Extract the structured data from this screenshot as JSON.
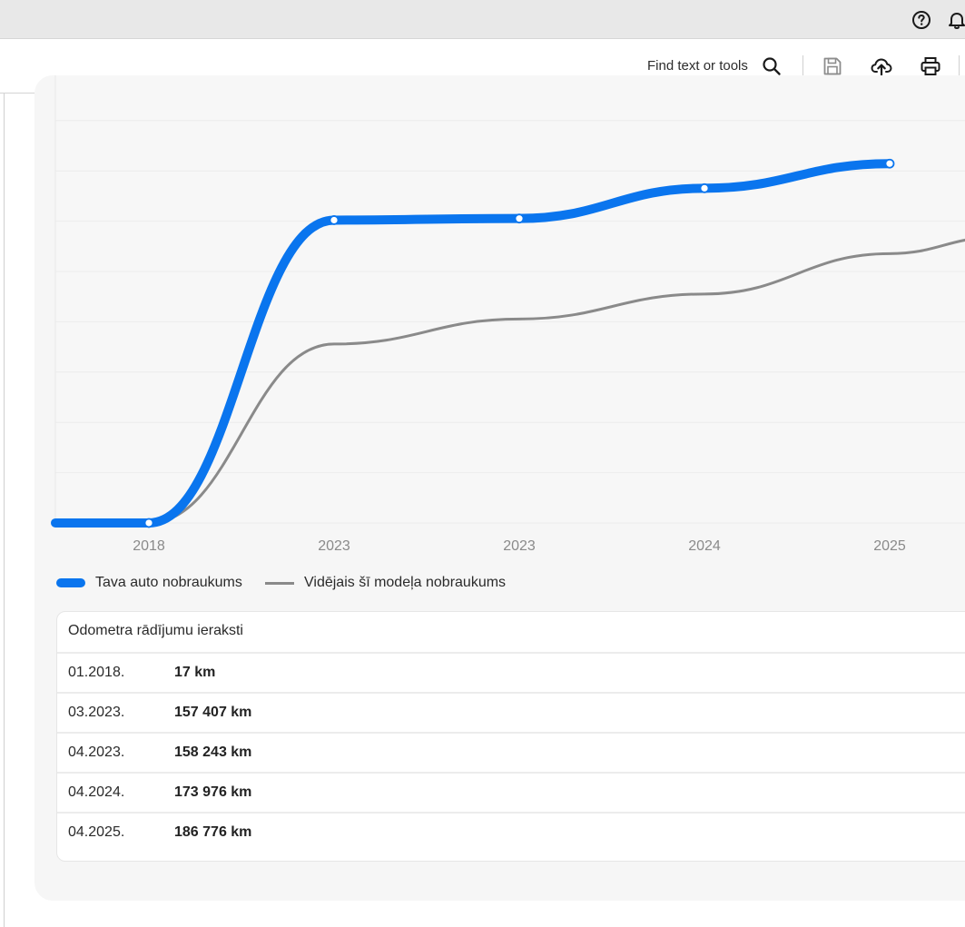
{
  "toolbar": {
    "find_label": "Find text or tools"
  },
  "icons": {
    "help": "help-circle-icon",
    "notifications": "bell-icon",
    "search": "search-icon",
    "save": "save-icon",
    "upload": "cloud-upload-icon",
    "print": "print-icon"
  },
  "chart_data": {
    "type": "line",
    "categories": [
      "2018",
      "2023",
      "2023",
      "2024",
      "2025"
    ],
    "series": [
      {
        "name": "Tava auto nobraukums",
        "color": "#0a75ee",
        "values": [
          17,
          157407,
          158243,
          173976,
          186776
        ]
      },
      {
        "name": "Vidējais šī modeļa nobraukums",
        "color": "#8a8a8a",
        "values": [
          17,
          93000,
          106000,
          119000,
          140000
        ]
      }
    ],
    "ylim": [
      0,
      210000
    ],
    "grid": true,
    "legend": "bottom-left"
  },
  "records": {
    "title": "Odometra rādījumu ieraksti",
    "rows": [
      {
        "date": "01.2018.",
        "km": "17 km"
      },
      {
        "date": "03.2023.",
        "km": "157 407 km"
      },
      {
        "date": "04.2023.",
        "km": "158 243 km"
      },
      {
        "date": "04.2024.",
        "km": "173 976 km"
      },
      {
        "date": "04.2025.",
        "km": "186 776 km"
      }
    ]
  }
}
